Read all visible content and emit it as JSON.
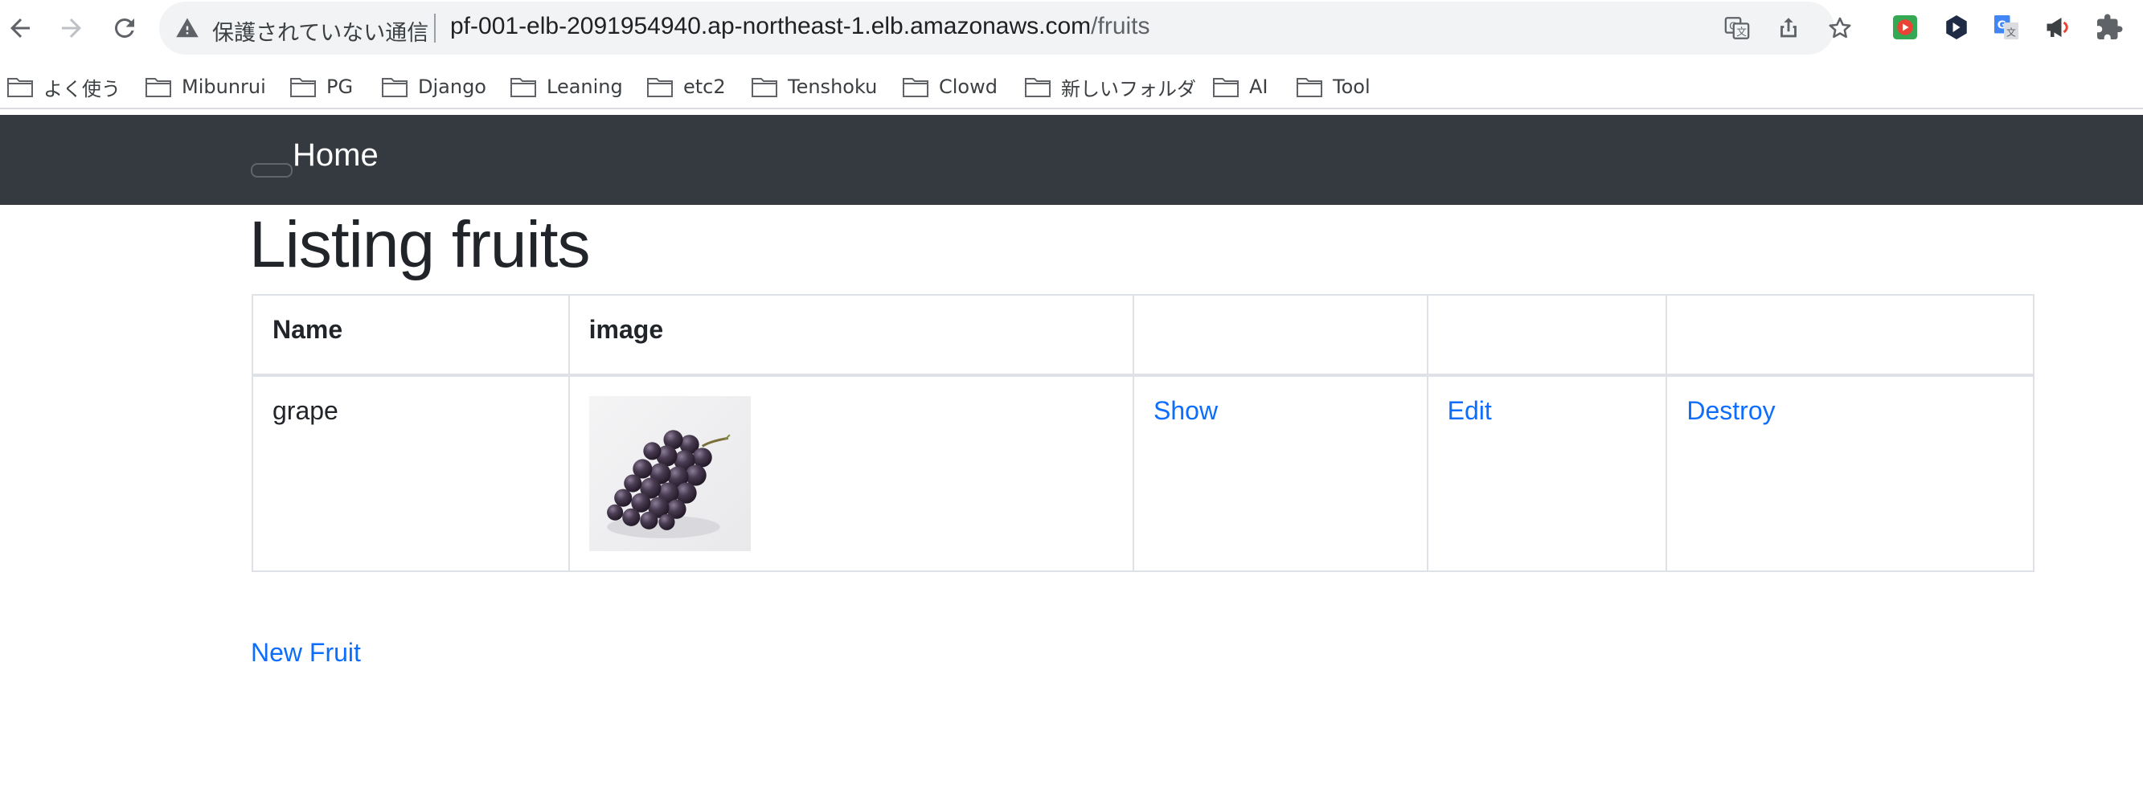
{
  "browser": {
    "security_label": "保護されていない通信",
    "url_host": "pf-001-elb-2091954940.ap-northeast-1.elb.amazonaws.com",
    "url_path": "/fruits",
    "bookmarks": [
      {
        "label": "よく使う"
      },
      {
        "label": "Mibunrui"
      },
      {
        "label": "PG"
      },
      {
        "label": "Django"
      },
      {
        "label": "Leaning"
      },
      {
        "label": "etc2"
      },
      {
        "label": "Tenshoku"
      },
      {
        "label": "Clowd"
      },
      {
        "label": "新しいフォルダ"
      },
      {
        "label": "AI"
      },
      {
        "label": "Tool"
      }
    ],
    "icons": [
      "back-arrow-icon",
      "forward-arrow-icon",
      "reload-icon",
      "warning-icon",
      "translate-icon",
      "share-icon",
      "star-icon",
      "folder-icon",
      "puzzle-icon"
    ]
  },
  "navbar": {
    "home_label": "Home",
    "background": "#343a40"
  },
  "page": {
    "title": "Listing fruits",
    "table": {
      "headers": [
        "Name",
        "image",
        "",
        "",
        ""
      ],
      "rows": [
        {
          "name": "grape",
          "image": "grape-image",
          "show": "Show",
          "edit": "Edit",
          "destroy": "Destroy"
        }
      ]
    },
    "new_link": "New Fruit",
    "link_color": "#0d6efd"
  }
}
